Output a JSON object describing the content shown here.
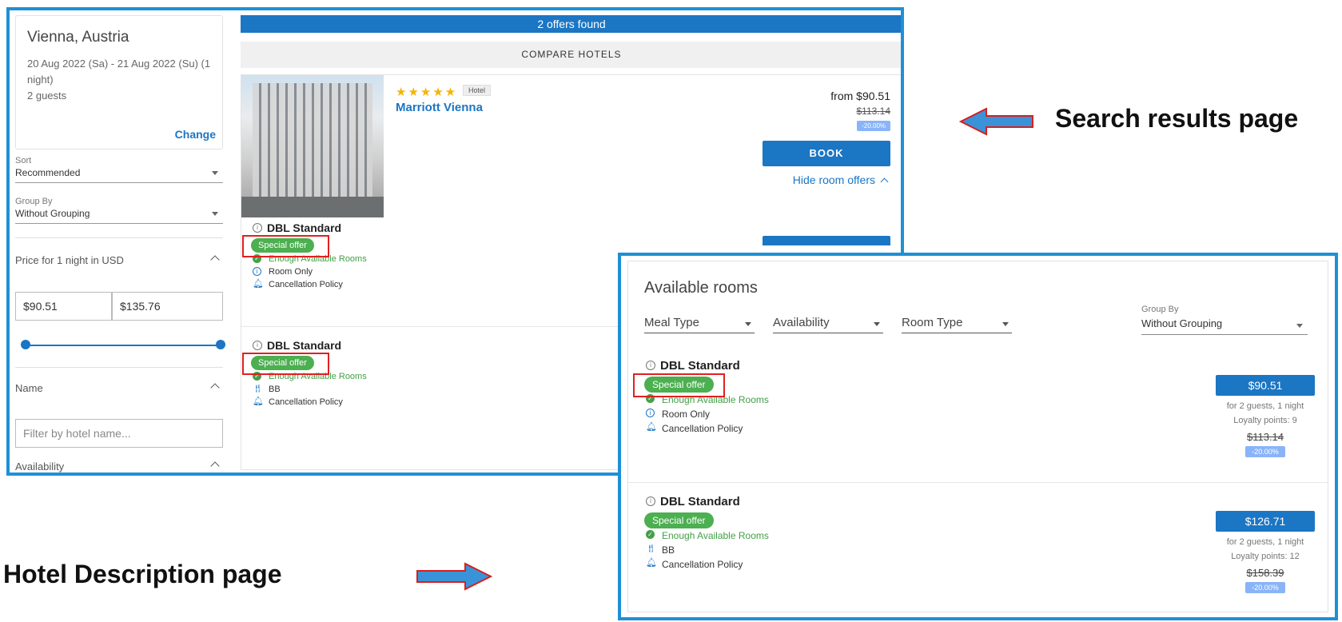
{
  "annotations": {
    "search_results_label": "Search results page",
    "hotel_description_label": "Hotel Description page"
  },
  "search_page": {
    "location": "Vienna, Austria",
    "dates": "20 Aug 2022 (Sa) - 21 Aug 2022 (Su) (1 night)",
    "guests": "2 guests",
    "change_label": "Change",
    "sort_label": "Sort",
    "sort_value": "Recommended",
    "group_by_label": "Group By",
    "group_by_value": "Without Grouping",
    "price_section": "Price for 1 night in USD",
    "price_min": "$90.51",
    "price_max": "$135.76",
    "name_section": "Name",
    "name_placeholder": "Filter by hotel name...",
    "availability_section": "Availability",
    "offers_found": "2 offers found",
    "compare_label": "COMPARE HOTELS",
    "hotel": {
      "stars": "★★★★★",
      "type_tag": "Hotel",
      "name": "Marriott Vienna",
      "from_price": "from $90.51",
      "old_price": "$113.14",
      "discount": "-20.00%",
      "book_label": "BOOK",
      "hide_offers_label": "Hide room offers"
    },
    "rooms": [
      {
        "title": "DBL Standard",
        "badge": "Special offer",
        "availability": "Enough Available Rooms",
        "meal": "Room Only",
        "policy": "Cancellation Policy"
      },
      {
        "title": "DBL Standard",
        "badge": "Special offer",
        "availability": "Enough Available Rooms",
        "meal": "BB",
        "policy": "Cancellation Policy"
      }
    ]
  },
  "hotel_page": {
    "title": "Available rooms",
    "filters": [
      "Meal Type",
      "Availability",
      "Room Type"
    ],
    "group_by_label": "Group By",
    "group_by_value": "Without Grouping",
    "rooms": [
      {
        "title": "DBL Standard",
        "badge": "Special offer",
        "availability": "Enough Available Rooms",
        "meal": "Room Only",
        "policy": "Cancellation Policy",
        "price": "$90.51",
        "price_note": "for 2 guests, 1 night",
        "loyalty": "Loyalty points: 9",
        "old_price": "$113.14",
        "discount": "-20.00%"
      },
      {
        "title": "DBL Standard",
        "badge": "Special offer",
        "availability": "Enough Available Rooms",
        "meal": "BB",
        "policy": "Cancellation Policy",
        "price": "$126.71",
        "price_note": "for 2 guests, 1 night",
        "loyalty": "Loyalty points: 12",
        "old_price": "$158.39",
        "discount": "-20.00%"
      }
    ]
  },
  "colors": {
    "brand_blue": "#1b76c4",
    "frame_blue": "#1e90d6",
    "offer_green": "#4caf50",
    "highlight_red": "#e02020"
  }
}
